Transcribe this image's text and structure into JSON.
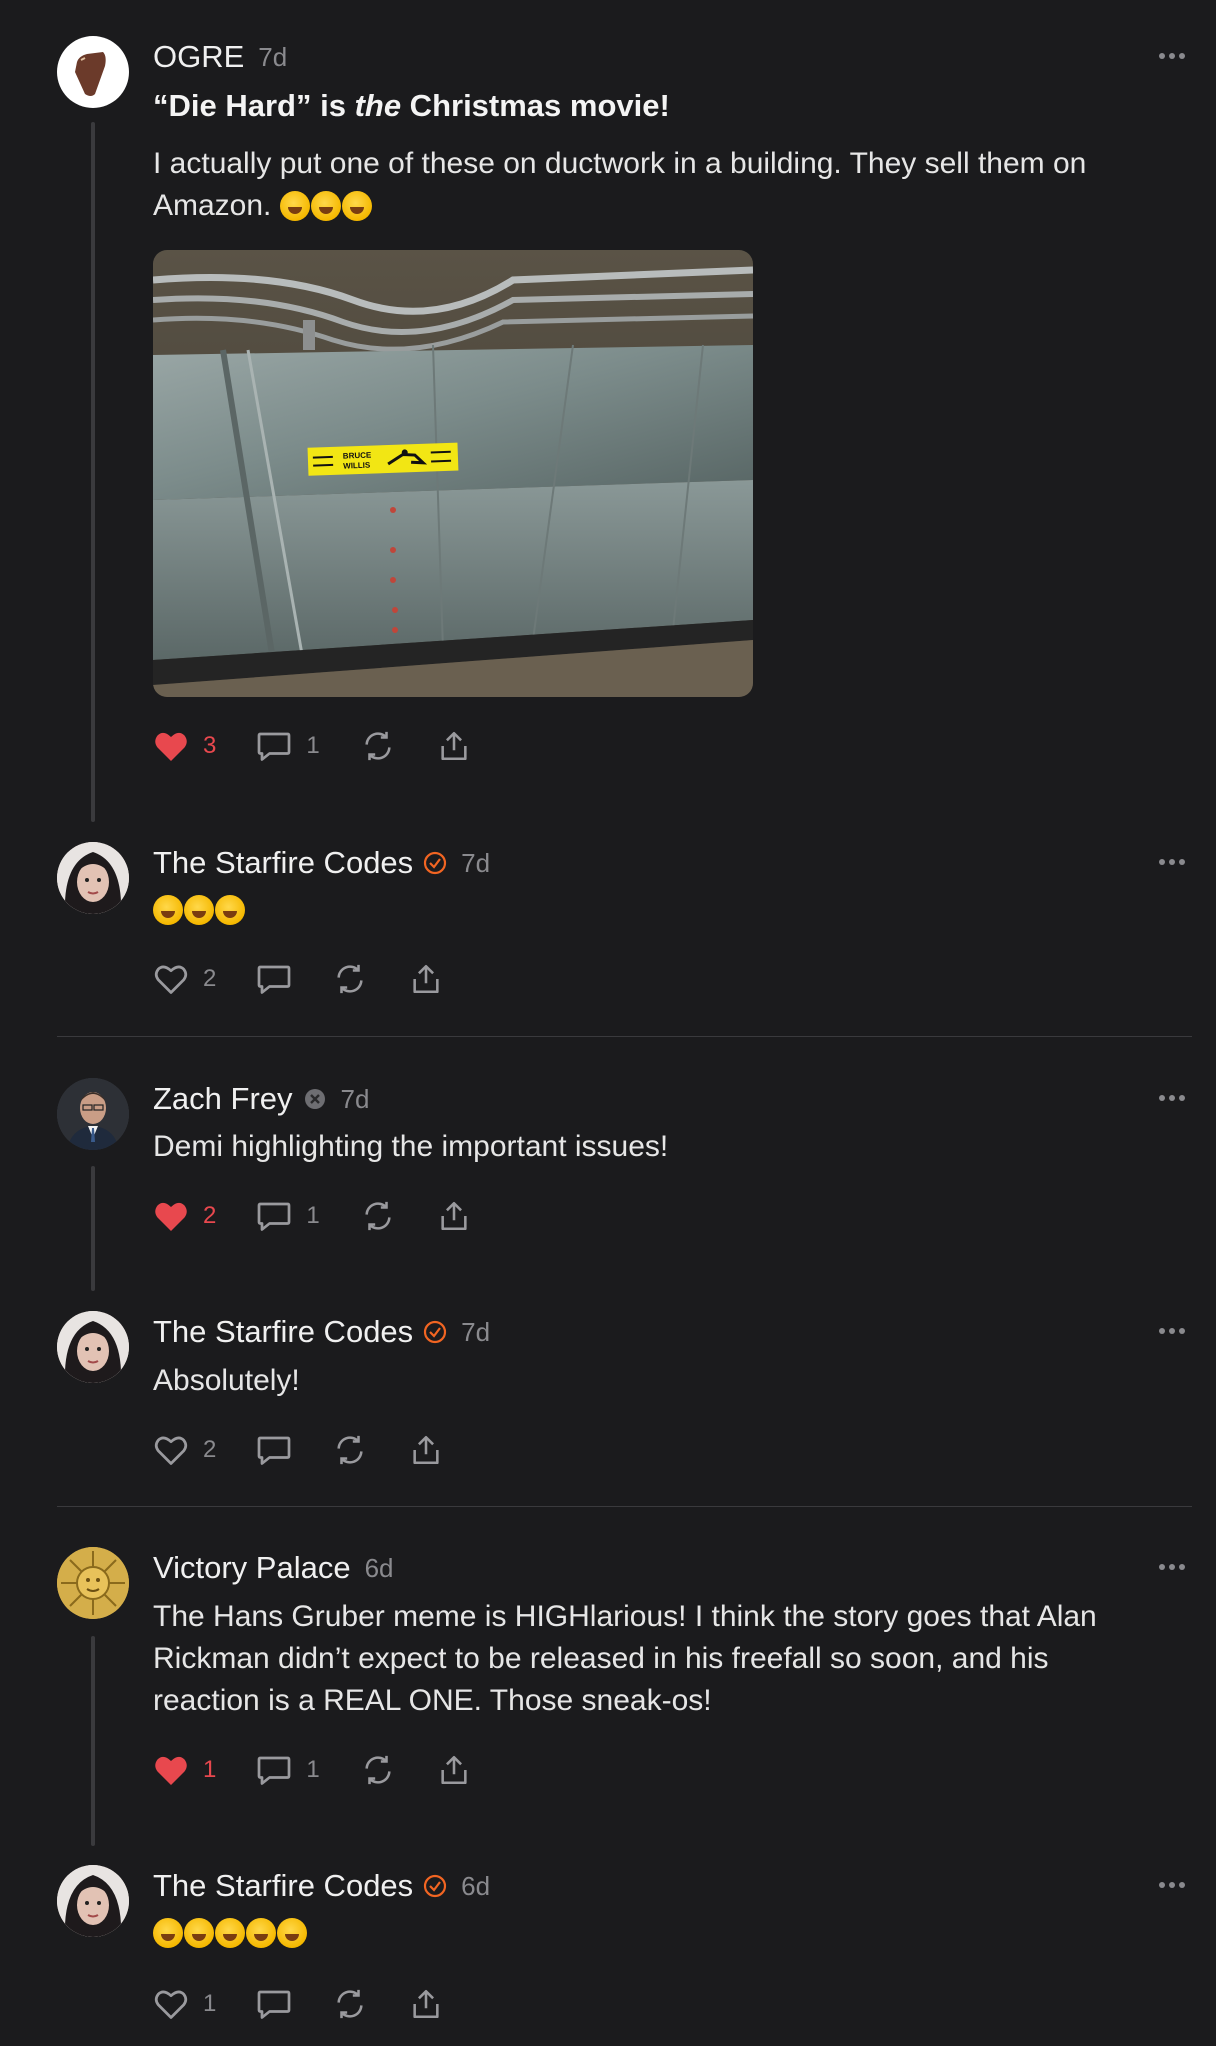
{
  "posts": [
    {
      "author": "OGRE",
      "time": "7d",
      "title_pre": "“Die Hard” is ",
      "title_em": "the",
      "title_post": " Christmas movie!",
      "body": "I actually put one of these on ductwork in a building. They sell them on Amazon.",
      "emoji_count": 3,
      "image": {
        "sticker_line1": "BRUCE",
        "sticker_line2": "WILLIS"
      },
      "likes": "3",
      "liked": true,
      "comments": "1"
    },
    {
      "author": "The Starfire Codes",
      "verified": true,
      "time": "7d",
      "emoji_count": 3,
      "likes": "2",
      "liked": false,
      "comments": ""
    },
    {
      "author": "Zach Frey",
      "time": "7d",
      "body": "Demi highlighting the important issues!",
      "likes": "2",
      "liked": true,
      "comments": "1"
    },
    {
      "author": "The Starfire Codes",
      "verified": true,
      "time": "7d",
      "body": "Absolutely!",
      "likes": "2",
      "liked": false,
      "comments": ""
    },
    {
      "author": "Victory Palace",
      "time": "6d",
      "body": "The Hans Gruber meme is HIGHlarious! I think the story goes that Alan Rickman didn’t expect to be released in his freefall so soon, and his reaction is a REAL ONE. Those sneak-os!",
      "likes": "1",
      "liked": true,
      "comments": "1"
    },
    {
      "author": "The Starfire Codes",
      "verified": true,
      "time": "6d",
      "emoji_count": 5,
      "likes": "1",
      "liked": false,
      "comments": ""
    }
  ],
  "icons": {
    "like": "heart-icon",
    "comment": "comment-bubble-icon",
    "repost": "repost-icon",
    "share": "share-icon",
    "more": "more-dots-icon",
    "verified": "verified-check-icon"
  },
  "colors": {
    "background": "#1b1b1d",
    "liked": "#e8484e",
    "verified": "#f26522",
    "muted": "#8a8a8e"
  }
}
